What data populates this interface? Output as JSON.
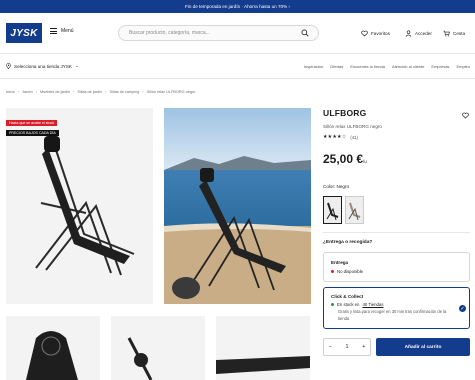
{
  "topbar": {
    "text": "Fin de temporada en jardín · Ahorra hasta un 70%  ›"
  },
  "header": {
    "logo": "JYSK",
    "menu_label": "Menú",
    "search_placeholder": "Buscar producto, categoría, marca...",
    "favorites_label": "Favoritos",
    "login_label": "Acceder",
    "cart_label": "Cesta"
  },
  "subnav": {
    "store_label": "Selecciona una tienda JYSK",
    "links": [
      "Inspiración",
      "Ofertas",
      "Encuentra tu tienda",
      "Atención al cliente",
      "Empresas",
      "Empleo"
    ]
  },
  "breadcrumbs": [
    "Inicio",
    "Jardín",
    "Muebles de jardín",
    "Sillas de jardín",
    "Sillas de camping",
    "Sillón relax ULFBORG negro"
  ],
  "gallery": {
    "badge_stock": "Hasta que se acabe el stock",
    "badge_price": "PRECIOS BAJOS CADA DÍA"
  },
  "product": {
    "title": "ULFBORG",
    "subtitle": "Sillón relax ULFBORG negro",
    "stars": "★★★★☆",
    "rating_count": "(41)",
    "price": "25,00 €",
    "price_unit": "/u",
    "color_label": "Color: Negro"
  },
  "delivery": {
    "question": "¿Entrega o recogida?",
    "delivery_title": "Entrega",
    "delivery_status": "No disponible",
    "cc_title": "Click & Collect",
    "cc_status_prefix": "En stock en",
    "cc_status_link": "40 Tiendas",
    "cc_desc": "Gratis y lista para recoger en 30 min tras confirmación de la tienda"
  },
  "purchase": {
    "minus": "−",
    "qty": "1",
    "plus": "+",
    "add_to_cart": "Añadir al carrito"
  },
  "colors": {
    "brand": "#143c8c",
    "sale_red": "#d9202a",
    "unavailable": "#d9202a",
    "available": "#1e9b4b"
  }
}
